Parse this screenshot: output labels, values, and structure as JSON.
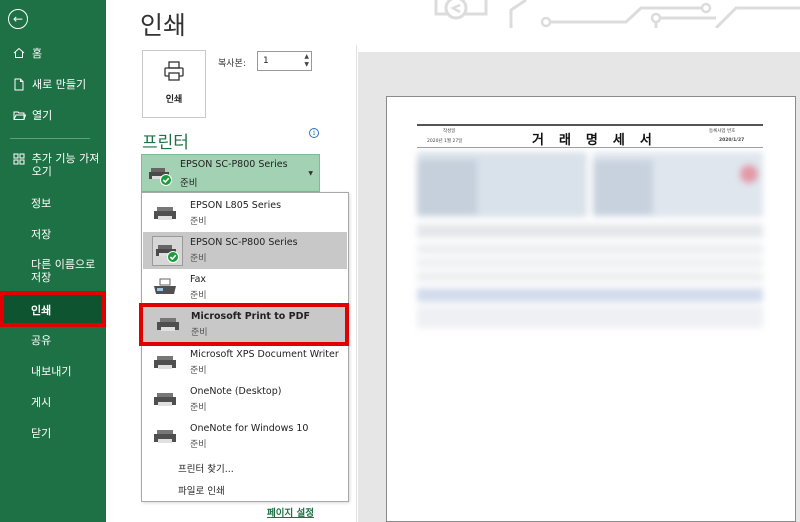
{
  "sidebar": {
    "back_icon": "back-arrow-icon",
    "items": [
      {
        "label": "홈",
        "icon": "home-icon"
      },
      {
        "label": "새로 만들기",
        "icon": "new-file-icon"
      },
      {
        "label": "열기",
        "icon": "folder-open-icon"
      },
      {
        "label": "추가 기능 가져오기",
        "icon": "add-ins-icon"
      },
      {
        "label": "정보"
      },
      {
        "label": "저장"
      },
      {
        "label": "다른 이름으로 저장"
      },
      {
        "label": "인쇄",
        "active": true
      },
      {
        "label": "공유"
      },
      {
        "label": "내보내기"
      },
      {
        "label": "게시"
      },
      {
        "label": "닫기"
      }
    ],
    "accent": "#1e7145",
    "highlight_color": "#e00000"
  },
  "main": {
    "title": "인쇄",
    "print_button_label": "인쇄",
    "copies_label": "복사본:",
    "copies_value": "1",
    "printer_section_title": "프린터",
    "selected_printer": {
      "name": "EPSON SC-P800 Series",
      "status": "준비"
    },
    "page_setup_link": "페이지 설정"
  },
  "dropdown": {
    "options": [
      {
        "name": "EPSON L805 Series",
        "status": "준비",
        "icon": "printer-icon"
      },
      {
        "name": "EPSON SC-P800 Series",
        "status": "준비",
        "icon": "printer-default-icon",
        "selected": true
      },
      {
        "name": "Fax",
        "status": "준비",
        "icon": "fax-icon"
      },
      {
        "name": "Microsoft Print to PDF",
        "status": "준비",
        "icon": "printer-icon",
        "highlighted": true
      },
      {
        "name": "Microsoft XPS Document Writer",
        "status": "준비",
        "icon": "printer-icon"
      },
      {
        "name": "OneNote (Desktop)",
        "status": "준비",
        "icon": "printer-icon"
      },
      {
        "name": "OneNote for Windows 10",
        "status": "준비",
        "icon": "printer-icon"
      }
    ],
    "find_printer": "프린터 찾기...",
    "print_to_file": "파일로 인쇄"
  },
  "preview": {
    "doc_title": "거래명세서",
    "left_label": "작성일",
    "left_value": "2020년 1월 27일",
    "right_label": "등록사업 번호",
    "right_value": "2020/1/27"
  }
}
